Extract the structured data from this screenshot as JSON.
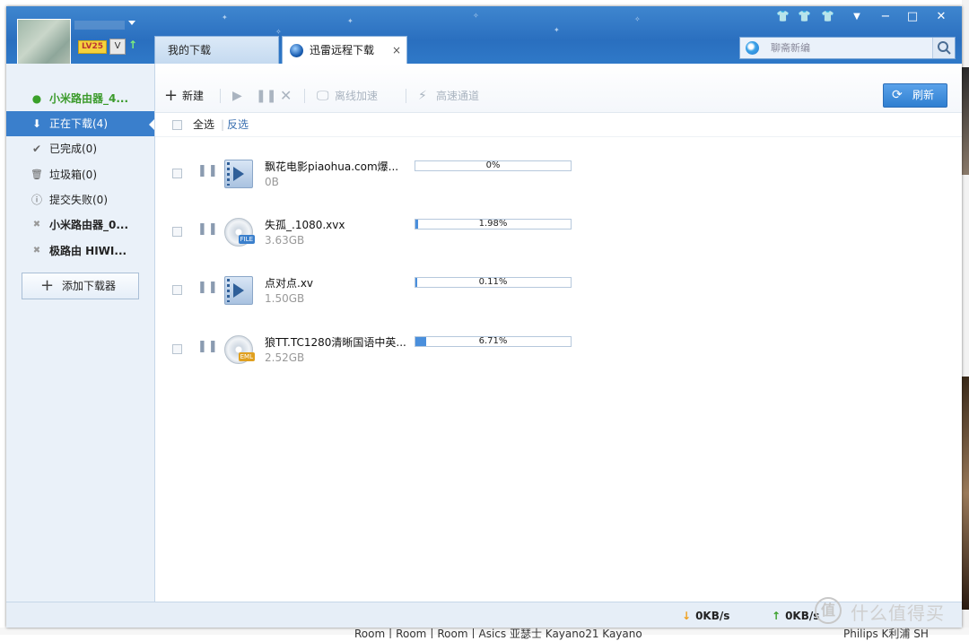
{
  "user": {
    "level_badge": "LV25",
    "vip_badge": "V"
  },
  "tabs": [
    {
      "label": "我的下载",
      "active": false
    },
    {
      "label": "迅雷远程下载",
      "active": true,
      "close": "×"
    }
  ],
  "window_controls": {
    "minimize": "−",
    "maximize": "□",
    "close": "✕",
    "menu": "▼"
  },
  "search": {
    "placeholder": "聊斋新编"
  },
  "sidebar": {
    "items": [
      {
        "label": "小米路由器_4...",
        "icon": "check-circle-icon",
        "glyph": "●"
      },
      {
        "label": "正在下载(4)",
        "icon": "arrow-down-icon",
        "glyph": "⬇"
      },
      {
        "label": "已完成(0)",
        "icon": "checkmark-icon",
        "glyph": "✔"
      },
      {
        "label": "垃圾箱(0)",
        "icon": "trash-icon",
        "glyph": "🗑"
      },
      {
        "label": "提交失败(0)",
        "icon": "info-icon",
        "glyph": "ⓘ"
      },
      {
        "label": "小米路由器_0...",
        "icon": "offline-icon",
        "glyph": "✖"
      },
      {
        "label": "极路由 HIWI...",
        "icon": "offline-icon",
        "glyph": "✖"
      }
    ],
    "add_button": "添加下载器"
  },
  "toolbar": {
    "new": "新建",
    "offline_accel": "离线加速",
    "high_speed": "高速通道",
    "refresh": "刷新"
  },
  "selection": {
    "select_all": "全选",
    "invert": "反选"
  },
  "downloads": [
    {
      "name": "飘花电影piaohua.com爆...",
      "size": "0B",
      "progress_text": "0%",
      "progress": 0,
      "file_type": "video"
    },
    {
      "name": "失孤_.1080.xvx",
      "size": "3.63GB",
      "progress_text": "1.98%",
      "progress": 1.98,
      "file_type": "FILE"
    },
    {
      "name": "点对点.xv",
      "size": "1.50GB",
      "progress_text": "0.11%",
      "progress": 0.11,
      "file_type": "video"
    },
    {
      "name": "狼TT.TC1280清晰国语中英...",
      "size": "2.52GB",
      "progress_text": "6.71%",
      "progress": 6.71,
      "file_type": "EML"
    }
  ],
  "status": {
    "down_speed": "0KB/s",
    "up_speed": "0KB/s"
  },
  "background_texts": {
    "bottom_left": "Room丨Room丨Room丨Asics 亚瑟士 Kayano21   Kayano",
    "bottom_right": "Philips  K利浦 SH"
  },
  "watermark": {
    "symbol": "值",
    "text": "什么值得买"
  },
  "colors": {
    "accent": "#3a7fcc",
    "title_bar": "#2f79c8",
    "progress": "#4a8fdc",
    "sidebar_bg": "#eaf1f9"
  }
}
